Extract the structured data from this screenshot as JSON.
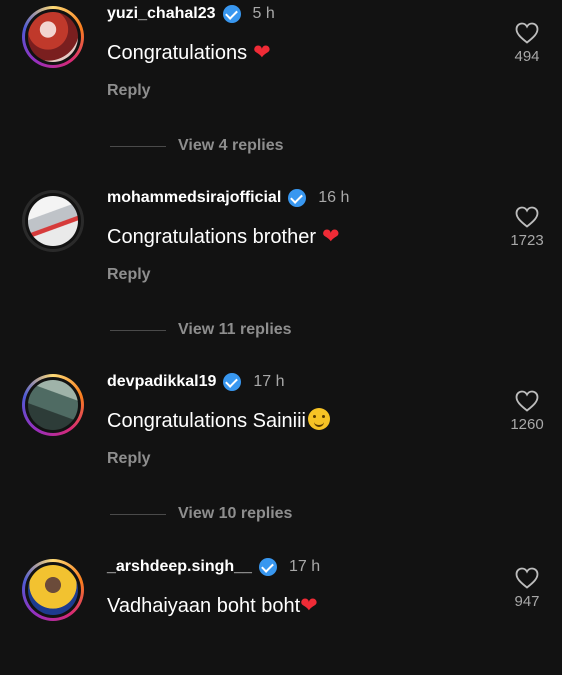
{
  "comments": [
    {
      "username": "yuzi_chahal23",
      "time": "5 h",
      "text": "Congratulations",
      "heart": "❤",
      "likes": "494",
      "reply": "Reply",
      "view_replies": "View 4 replies"
    },
    {
      "username": "mohammedsirajofficial",
      "time": "16 h",
      "text": "Congratulations brother",
      "heart": "❤",
      "likes": "1723",
      "reply": "Reply",
      "view_replies": "View 11 replies"
    },
    {
      "username": "devpadikkal19",
      "time": "17 h",
      "text": "Congratulations Sainiii",
      "likes": "1260",
      "reply": "Reply",
      "view_replies": "View 10 replies"
    },
    {
      "username": "_arshdeep.singh__",
      "time": "17 h",
      "text": "Vadhaiyaan boht boht",
      "heart": "❤",
      "likes": "947"
    }
  ],
  "colors": {
    "background": "#121212",
    "verified": "#3897f0",
    "heart": "#ef2b36",
    "muted": "#8e8e8e"
  },
  "icons": [
    "verified-badge-icon",
    "heart-outline-icon",
    "heart-emoji-icon",
    "hugging-emoji-icon"
  ]
}
